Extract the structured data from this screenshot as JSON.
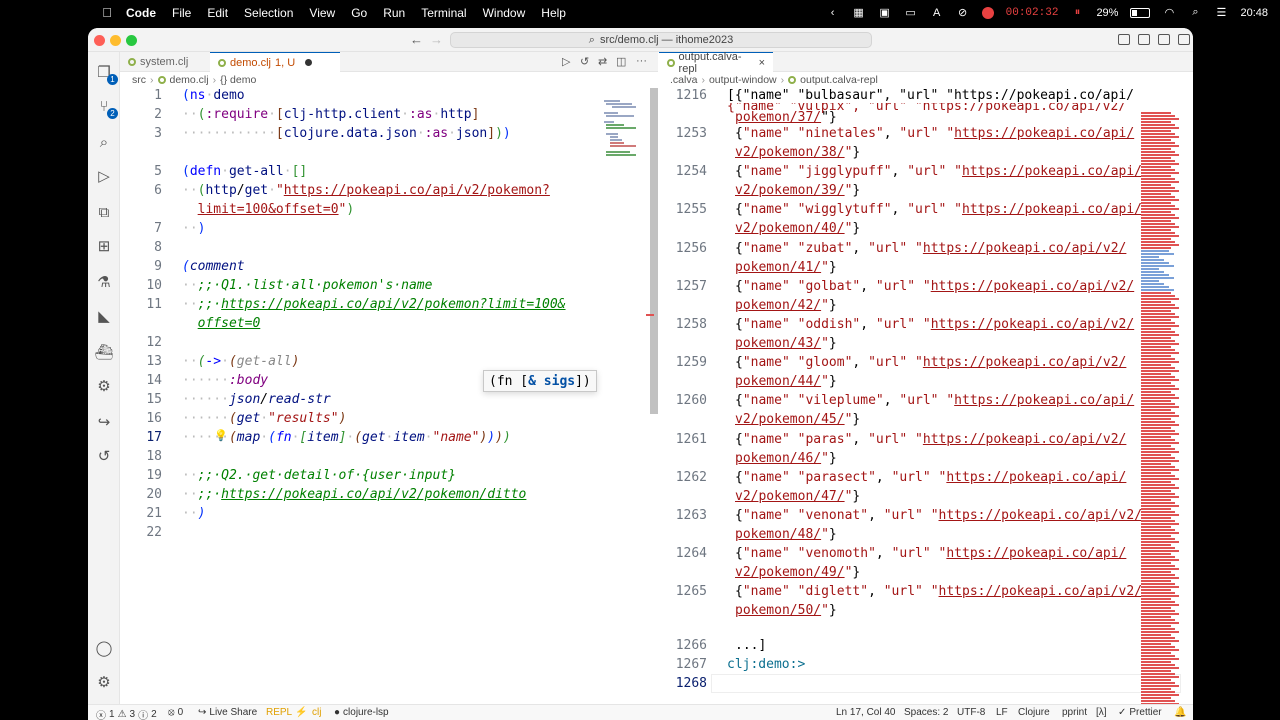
{
  "menubar": {
    "app_name": "Code",
    "items": [
      "File",
      "Edit",
      "Selection",
      "View",
      "Go",
      "Run",
      "Terminal",
      "Window",
      "Help"
    ],
    "recording_time": "00:02:32",
    "battery": "29%",
    "clock": "20:48"
  },
  "window": {
    "title": "src/demo.clj — ithome2023"
  },
  "activity_badges": {
    "explorer": "1",
    "scm": "2"
  },
  "left_group": {
    "tabs": [
      {
        "label": "system.clj"
      },
      {
        "label": "demo.clj",
        "status": "1, U"
      }
    ],
    "breadcrumb": {
      "folder": "src",
      "file": "demo.clj",
      "symbol": "{} demo"
    },
    "line_numbers": [
      "1",
      "2",
      "3",
      "",
      "5",
      "6",
      "",
      "7",
      "8",
      "9",
      "10",
      "11",
      "",
      "12",
      "13",
      "14",
      "15",
      "16",
      "17",
      "18",
      "19",
      "20",
      "21",
      "22"
    ],
    "tooltip": {
      "prefix": "(fn [",
      "amp": "&",
      "sigs": "sigs",
      "suffix": "])"
    }
  },
  "right_group": {
    "tabs": [
      {
        "label": "output.calva-repl"
      }
    ],
    "breadcrumb": {
      "folder": ".calva",
      "sub": "output-window",
      "file": "output.calva-repl"
    },
    "first_line": {
      "num": "1216",
      "text": "[{\"name\" \"bulbasaur\", \"url\" \"https://pokeapi.co/api/"
    },
    "entries": [
      {
        "num": "1253",
        "name": "ninetales",
        "url_a": "https://pokeapi.co/api/",
        "url_b": "v2/pokemon/38/"
      },
      {
        "num": "1254",
        "name": "jigglypuff",
        "url_a": "https://pokeapi.co/api/",
        "url_b": "v2/pokemon/39/"
      },
      {
        "num": "1255",
        "name": "wigglytuff",
        "url_a": "https://pokeapi.co/api/",
        "url_b": "v2/pokemon/40/"
      },
      {
        "num": "1256",
        "name": "zubat",
        "url_a": "https://pokeapi.co/api/v2/",
        "url_b": "pokemon/41/"
      },
      {
        "num": "1257",
        "name": "golbat",
        "url_a": "https://pokeapi.co/api/v2/",
        "url_b": "pokemon/42/"
      },
      {
        "num": "1258",
        "name": "oddish",
        "url_a": "https://pokeapi.co/api/v2/",
        "url_b": "pokemon/43/"
      },
      {
        "num": "1259",
        "name": "gloom",
        "url_a": "https://pokeapi.co/api/v2/",
        "url_b": "pokemon/44/"
      },
      {
        "num": "1260",
        "name": "vileplume",
        "url_a": "https://pokeapi.co/api/",
        "url_b": "v2/pokemon/45/"
      },
      {
        "num": "1261",
        "name": "paras",
        "url_a": "https://pokeapi.co/api/v2/",
        "url_b": "pokemon/46/"
      },
      {
        "num": "1262",
        "name": "parasect",
        "url_a": "https://pokeapi.co/api/",
        "url_b": "v2/pokemon/47/"
      },
      {
        "num": "1263",
        "name": "venonat",
        "url_a": "https://pokeapi.co/api/v2/",
        "url_b": "pokemon/48/"
      },
      {
        "num": "1264",
        "name": "venomoth",
        "url_a": "https://pokeapi.co/api/",
        "url_b": "v2/pokemon/49/"
      },
      {
        "num": "1265",
        "name": "diglett",
        "url_a": "https://pokeapi.co/api/v2/",
        "url_b": "pokemon/50/"
      }
    ],
    "line_1266": {
      "num": "1266",
      "text": "...]"
    },
    "line_1267": {
      "num": "1267",
      "text": "clj:demo:>"
    },
    "line_1268": {
      "num": "1268"
    },
    "partial_top": "{\"name\" \"vulpix\", \"url\" \"https://pokeapi.co/api/v2/",
    "partial_top2": "pokemon/37/"
  },
  "statusbar": {
    "errors": "1",
    "warnings": "3",
    "infos": "2",
    "ports": "0",
    "live_share": "Live Share",
    "repl": "REPL",
    "clj": "clj",
    "lsp": "clojure-lsp",
    "position": "Ln 17, Col 40",
    "spaces": "Spaces: 2",
    "encoding": "UTF-8",
    "eol": "LF",
    "language": "Clojure",
    "pprint": "pprint",
    "lambda": "[λ]",
    "prettier": "Prettier"
  },
  "colors": {
    "accent": "#005fb8",
    "string": "#a31515",
    "comment": "#008000",
    "keyword": "#800080"
  }
}
